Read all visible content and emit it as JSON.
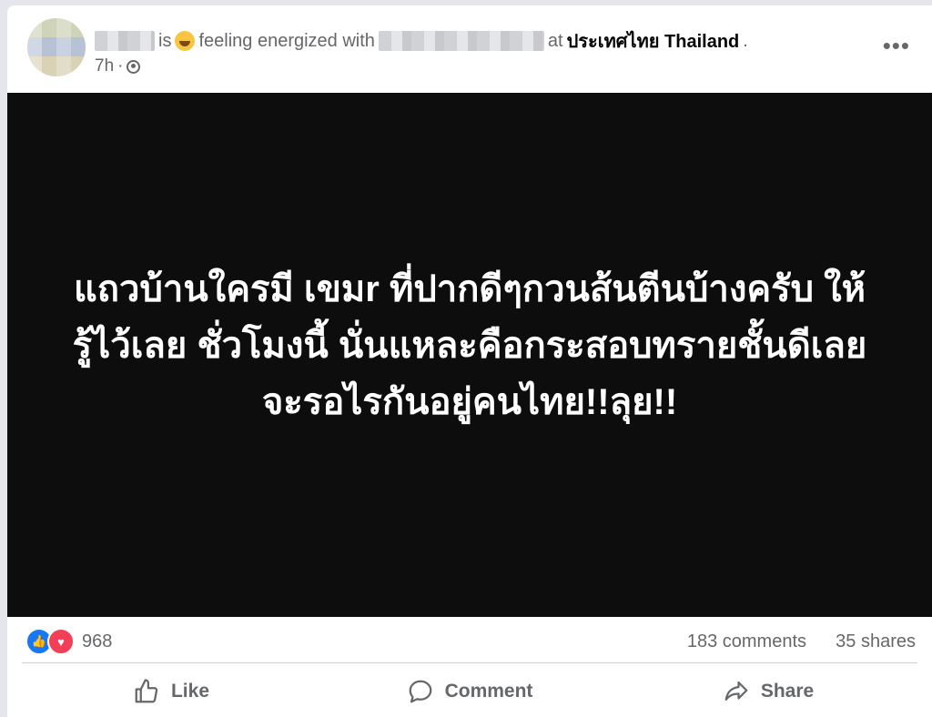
{
  "post": {
    "header": {
      "is_text": "is",
      "feeling_text": "feeling energized with",
      "at_text": "at",
      "place": "ประเทศไทย Thailand",
      "period": ".",
      "time": "7h",
      "dot": "·"
    },
    "more_label": "•••",
    "image_text_lines": [
      "แถวบ้านใครมี เขมr ที่ปากดีๆกวนส้นตีนบ้างครับ ให้",
      "รู้ไว้เลย ชั่วโมงนี้ นั่นแหละคือกระสอบทรายชั้นดีเลย",
      "จะรอไรกันอยู่คนไทย!!ลุย!!"
    ],
    "stats": {
      "reaction_count": "968",
      "comments": "183 comments",
      "shares": "35 shares"
    },
    "actions": {
      "like": "Like",
      "comment": "Comment",
      "share": "Share"
    }
  }
}
